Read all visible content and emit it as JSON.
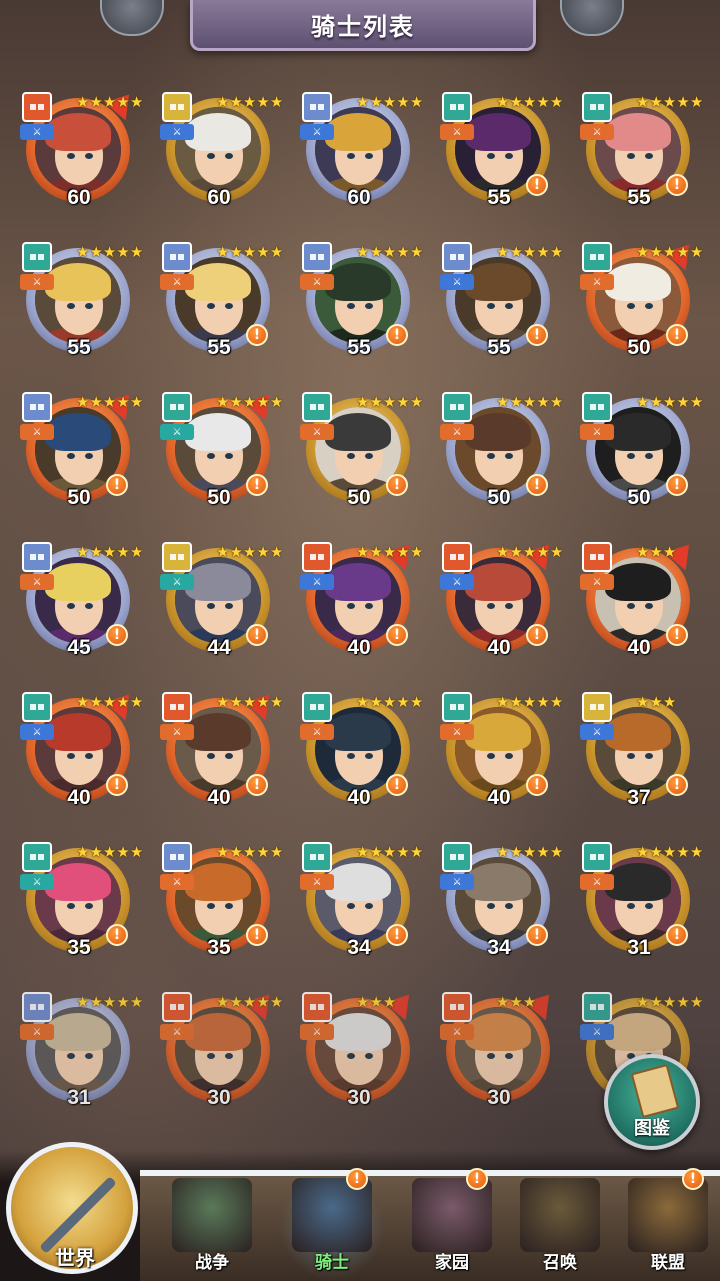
{
  "header": {
    "title": "骑士列表"
  },
  "heroes": [
    {
      "level": "60",
      "stars": 5,
      "frame": "red",
      "rank": "red",
      "cls": "blue",
      "alert": false,
      "flag": true,
      "hair": "#c8503a",
      "bg": "#5a3a3a",
      "body": "#7a2f2a"
    },
    {
      "level": "60",
      "stars": 5,
      "frame": "gold",
      "rank": "gold",
      "cls": "blue",
      "alert": false,
      "flag": false,
      "hair": "#eae8e2",
      "bg": "#6b5a42",
      "body": "#5a4a3a"
    },
    {
      "level": "60",
      "stars": 5,
      "frame": "blue",
      "rank": "blue",
      "cls": "blue",
      "alert": false,
      "flag": false,
      "hair": "#d9a53a",
      "bg": "#3d3a55",
      "body": "#7a5a2a"
    },
    {
      "level": "55",
      "stars": 5,
      "frame": "gold",
      "rank": "teal",
      "cls": "orange",
      "alert": true,
      "flag": false,
      "hair": "#5a2a6a",
      "bg": "#2a2035",
      "body": "#2a2a2a"
    },
    {
      "level": "55",
      "stars": 5,
      "frame": "gold",
      "rank": "teal",
      "cls": "orange",
      "alert": true,
      "flag": false,
      "hair": "#e28a8a",
      "bg": "#6a4a4a",
      "body": "#8a2a2a"
    },
    {
      "level": "55",
      "stars": 5,
      "frame": "blue",
      "rank": "teal",
      "cls": "orange",
      "alert": false,
      "flag": false,
      "hair": "#e7c35a",
      "bg": "#5a4a3a",
      "body": "#9a3a2a"
    },
    {
      "level": "55",
      "stars": 5,
      "frame": "blue",
      "rank": "blue",
      "cls": "orange",
      "alert": true,
      "flag": false,
      "hair": "#efd07a",
      "bg": "#4a3a2a",
      "body": "#3a3a4a"
    },
    {
      "level": "55",
      "stars": 5,
      "frame": "blue",
      "rank": "blue",
      "cls": "orange",
      "alert": true,
      "flag": false,
      "hair": "#2a3a2a",
      "bg": "#3a5a3a",
      "body": "#1e2a1e"
    },
    {
      "level": "55",
      "stars": 5,
      "frame": "blue",
      "rank": "blue",
      "cls": "blue",
      "alert": true,
      "flag": false,
      "hair": "#6a4a2a",
      "bg": "#4a3a2a",
      "body": "#5a4a3a"
    },
    {
      "level": "50",
      "stars": 5,
      "frame": "red",
      "rank": "teal",
      "cls": "orange",
      "alert": true,
      "flag": true,
      "hair": "#f0ece2",
      "bg": "#8a5a3a",
      "body": "#6a2a1a"
    },
    {
      "level": "50",
      "stars": 5,
      "frame": "red",
      "rank": "blue",
      "cls": "orange",
      "alert": true,
      "flag": true,
      "hair": "#2a4a7a",
      "bg": "#4a3a2a",
      "body": "#6a5a3a"
    },
    {
      "level": "50",
      "stars": 5,
      "frame": "red",
      "rank": "teal",
      "cls": "teal",
      "alert": true,
      "flag": true,
      "hair": "#e8e8e8",
      "bg": "#5a4a3a",
      "body": "#4a4a5a"
    },
    {
      "level": "50",
      "stars": 5,
      "frame": "gold",
      "rank": "teal",
      "cls": "orange",
      "alert": true,
      "flag": false,
      "hair": "#3a3a3a",
      "bg": "#d8d0c2",
      "body": "#5a4a3a"
    },
    {
      "level": "50",
      "stars": 5,
      "frame": "blue",
      "rank": "teal",
      "cls": "orange",
      "alert": true,
      "flag": false,
      "hair": "#5a3a2a",
      "bg": "#6a4a2a",
      "body": "#6a4a2a"
    },
    {
      "level": "50",
      "stars": 5,
      "frame": "blue",
      "rank": "teal",
      "cls": "orange",
      "alert": true,
      "flag": false,
      "hair": "#2a2a2a",
      "bg": "#1e1e1e",
      "body": "#4a4a4a"
    },
    {
      "level": "45",
      "stars": 5,
      "frame": "blue",
      "rank": "blue",
      "cls": "orange",
      "alert": true,
      "flag": false,
      "hair": "#e8d060",
      "bg": "#3a2a4a",
      "body": "#5a2a6a"
    },
    {
      "level": "44",
      "stars": 5,
      "frame": "gold",
      "rank": "gold",
      "cls": "teal",
      "alert": true,
      "flag": false,
      "hair": "#8a8a9a",
      "bg": "#4a4a5a",
      "body": "#2a3a5a"
    },
    {
      "level": "40",
      "stars": 5,
      "frame": "red",
      "rank": "red",
      "cls": "blue",
      "alert": true,
      "flag": true,
      "hair": "#6a3a8a",
      "bg": "#3a2a4a",
      "body": "#4a2a5a"
    },
    {
      "level": "40",
      "stars": 5,
      "frame": "red",
      "rank": "red",
      "cls": "blue",
      "alert": true,
      "flag": true,
      "hair": "#b84a3a",
      "bg": "#3a2a3a",
      "body": "#8a2a2a"
    },
    {
      "level": "40",
      "stars": 3,
      "frame": "red",
      "rank": "red",
      "cls": "orange",
      "alert": true,
      "flag": true,
      "hair": "#1e1e1e",
      "bg": "#c8c0b0",
      "body": "#2a2a2a"
    },
    {
      "level": "40",
      "stars": 5,
      "frame": "red",
      "rank": "teal",
      "cls": "blue",
      "alert": true,
      "flag": true,
      "hair": "#b83a2a",
      "bg": "#5a3a3a",
      "body": "#4a2a2a"
    },
    {
      "level": "40",
      "stars": 5,
      "frame": "red",
      "rank": "red",
      "cls": "orange",
      "alert": true,
      "flag": true,
      "hair": "#5a3a2a",
      "bg": "#6a5a4a",
      "body": "#4a3a2a"
    },
    {
      "level": "40",
      "stars": 5,
      "frame": "gold",
      "rank": "teal",
      "cls": "orange",
      "alert": true,
      "flag": false,
      "hair": "#2a3a4a",
      "bg": "#1e2a3a",
      "body": "#2a3a4a"
    },
    {
      "level": "40",
      "stars": 5,
      "frame": "gold",
      "rank": "teal",
      "cls": "orange",
      "alert": true,
      "flag": false,
      "hair": "#d8a83a",
      "bg": "#8a5a2a",
      "body": "#6a4a1a"
    },
    {
      "level": "37",
      "stars": 3,
      "frame": "gold",
      "rank": "gold",
      "cls": "blue",
      "alert": true,
      "flag": false,
      "hair": "#b86a2a",
      "bg": "#5a4a3a",
      "body": "#3a3a2a"
    },
    {
      "level": "35",
      "stars": 5,
      "frame": "gold",
      "rank": "teal",
      "cls": "teal",
      "alert": true,
      "flag": false,
      "hair": "#e0507a",
      "bg": "#6a3a4a",
      "body": "#4a2a3a"
    },
    {
      "level": "35",
      "stars": 5,
      "frame": "red",
      "rank": "blue",
      "cls": "orange",
      "alert": true,
      "flag": false,
      "hair": "#c86a2a",
      "bg": "#6a4a2a",
      "body": "#3a5a3a"
    },
    {
      "level": "34",
      "stars": 5,
      "frame": "gold",
      "rank": "teal",
      "cls": "orange",
      "alert": true,
      "flag": false,
      "hair": "#dedede",
      "bg": "#5a5a6a",
      "body": "#3a3a5a"
    },
    {
      "level": "34",
      "stars": 5,
      "frame": "blue",
      "rank": "teal",
      "cls": "blue",
      "alert": true,
      "flag": false,
      "hair": "#8a7a6a",
      "bg": "#5a4a3a",
      "body": "#3a3a3a"
    },
    {
      "level": "31",
      "stars": 5,
      "frame": "gold",
      "rank": "teal",
      "cls": "orange",
      "alert": true,
      "flag": false,
      "hair": "#2a2a2a",
      "bg": "#6a3a4a",
      "body": "#3a2a2a"
    },
    {
      "level": "31",
      "stars": 5,
      "frame": "blue",
      "rank": "blue",
      "cls": "orange",
      "alert": false,
      "flag": false,
      "hair": "#c8b89a",
      "bg": "#5a5a5a",
      "body": "#6a5a4a"
    },
    {
      "level": "30",
      "stars": 5,
      "frame": "red",
      "rank": "red",
      "cls": "orange",
      "alert": false,
      "flag": true,
      "hair": "#c86a3a",
      "bg": "#5a4a3a",
      "body": "#3a2a2a"
    },
    {
      "level": "30",
      "stars": 3,
      "frame": "red",
      "rank": "red",
      "cls": "orange",
      "alert": false,
      "flag": true,
      "hair": "#e0e0e0",
      "bg": "#6a4a3a",
      "body": "#5a3a2a"
    },
    {
      "level": "30",
      "stars": 3,
      "frame": "red",
      "rank": "red",
      "cls": "orange",
      "alert": false,
      "flag": true,
      "hair": "#d88a4a",
      "bg": "#6a5a4a",
      "body": "#5a4a3a"
    },
    {
      "level": "",
      "stars": 5,
      "frame": "gold",
      "rank": "teal",
      "cls": "blue",
      "alert": false,
      "flag": false,
      "hair": "#d8b88a",
      "bg": "#5a4a3a",
      "body": "#4a3a2a"
    }
  ],
  "atlas": {
    "label": "图鉴"
  },
  "nav": {
    "world": "世界",
    "items": [
      {
        "label": "战争",
        "active": false,
        "alert": false,
        "color": "#5a7a5a"
      },
      {
        "label": "骑士",
        "active": true,
        "alert": true,
        "color": "#4a6a8a"
      },
      {
        "label": "家园",
        "active": false,
        "alert": true,
        "color": "#7a5a6a"
      },
      {
        "label": "召唤",
        "active": false,
        "alert": false,
        "color": "#6a5a3a"
      },
      {
        "label": "联盟",
        "active": false,
        "alert": true,
        "color": "#8a6a3a"
      }
    ]
  },
  "alert_symbol": "!",
  "star_symbol": "★",
  "icons": {
    "alert": "exclamation-icon",
    "compass": "compass-icon",
    "book": "book-icon"
  }
}
